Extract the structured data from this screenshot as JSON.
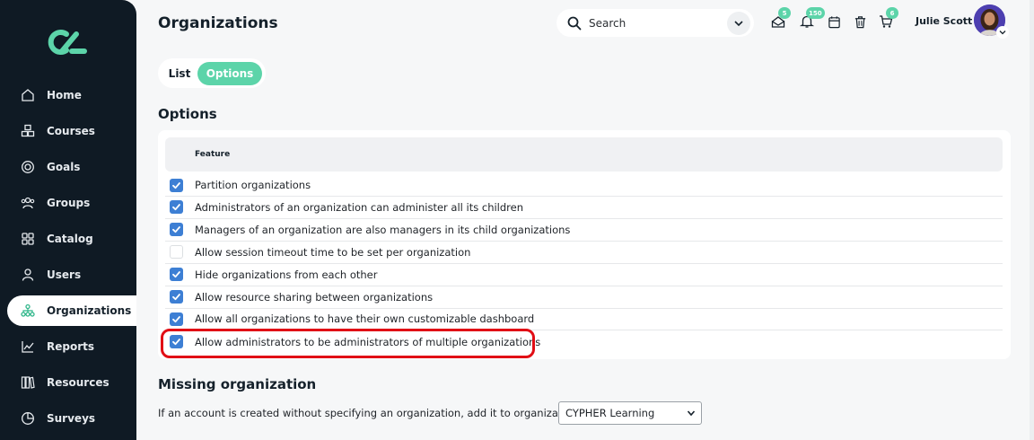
{
  "sidebar": {
    "items": [
      {
        "label": "Home",
        "icon": "home-icon"
      },
      {
        "label": "Courses",
        "icon": "courses-icon"
      },
      {
        "label": "Goals",
        "icon": "goals-icon"
      },
      {
        "label": "Groups",
        "icon": "groups-icon"
      },
      {
        "label": "Catalog",
        "icon": "catalog-icon"
      },
      {
        "label": "Users",
        "icon": "users-icon"
      },
      {
        "label": "Organizations",
        "icon": "organizations-icon",
        "active": true
      },
      {
        "label": "Reports",
        "icon": "reports-icon"
      },
      {
        "label": "Resources",
        "icon": "resources-icon"
      },
      {
        "label": "Surveys",
        "icon": "surveys-icon"
      }
    ]
  },
  "header": {
    "title": "Organizations",
    "search_placeholder": "Search",
    "badges": {
      "inbox": "5",
      "notifications": "150",
      "cart": "6"
    },
    "user_name": "Julie Scott"
  },
  "tabs": [
    {
      "label": "List"
    },
    {
      "label": "Options",
      "active": true
    }
  ],
  "options": {
    "title": "Options",
    "column_header": "Feature",
    "rows": [
      {
        "label": "Partition organizations",
        "checked": true
      },
      {
        "label": "Administrators of an organization can administer all its children",
        "checked": true
      },
      {
        "label": "Managers of an organization are also managers in its child organizations",
        "checked": true
      },
      {
        "label": "Allow session timeout time to be set per organization",
        "checked": false
      },
      {
        "label": "Hide organizations from each other",
        "checked": true
      },
      {
        "label": "Allow resource sharing between organizations",
        "checked": true
      },
      {
        "label": "Allow all organizations to have their own customizable dashboard",
        "checked": true
      },
      {
        "label": "Allow administrators to be administrators of multiple organizations",
        "checked": true
      }
    ]
  },
  "missing": {
    "title": "Missing organization",
    "text": "If an account is created without specifying an organization, add it to organization:",
    "selected": "CYPHER Learning"
  },
  "colors": {
    "sidebar_bg": "#0f1a24",
    "accent": "#5cd4a9",
    "checkbox": "#3d7fd4",
    "highlight": "#e10e15"
  }
}
